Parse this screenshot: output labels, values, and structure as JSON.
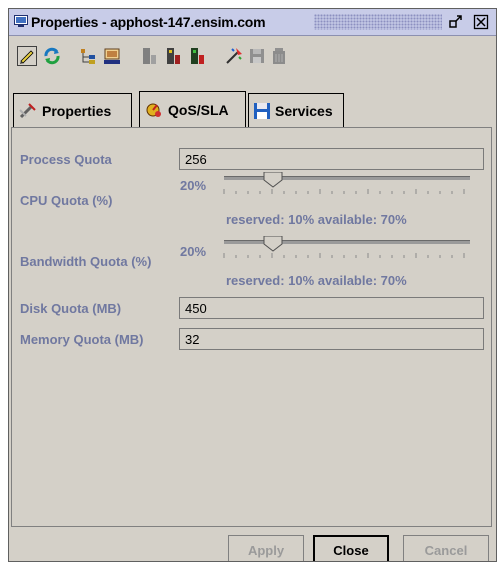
{
  "window": {
    "title": "Properties - apphost-147.ensim.com"
  },
  "tabs": [
    {
      "label": "Properties",
      "icon": "properties-icon",
      "active": false
    },
    {
      "label": "QoS/SLA",
      "icon": "qos-icon",
      "active": true
    },
    {
      "label": "Services",
      "icon": "floppy-disk-icon",
      "active": false
    }
  ],
  "toolbar": {
    "icons": [
      "pencil-icon",
      "refresh-icon",
      "tree-icon",
      "monitor-icon",
      "server-icon",
      "server-colored-icon",
      "server-green-icon",
      "wizard-icon",
      "save-icon",
      "trash-icon"
    ]
  },
  "form": {
    "process_quota": {
      "label": "Process Quota",
      "value": "256"
    },
    "cpu_quota": {
      "label": "CPU Quota (%)",
      "percent": "20%",
      "level": 0.2,
      "reserved_text": "reserved: 10% available: 70%"
    },
    "bandwidth_quota": {
      "label": "Bandwidth Quota (%)",
      "percent": "20%",
      "level": 0.2,
      "reserved_text": "reserved: 10% available: 70%"
    },
    "disk_quota": {
      "label": "Disk Quota (MB)",
      "value": "450"
    },
    "memory_quota": {
      "label": "Memory Quota (MB)",
      "value": "32"
    }
  },
  "buttons": {
    "apply": "Apply",
    "close": "Close",
    "cancel": "Cancel"
  },
  "colors": {
    "label": "#7078a0",
    "titlebar": "#c8cce8",
    "window": "#d4d0c8"
  }
}
